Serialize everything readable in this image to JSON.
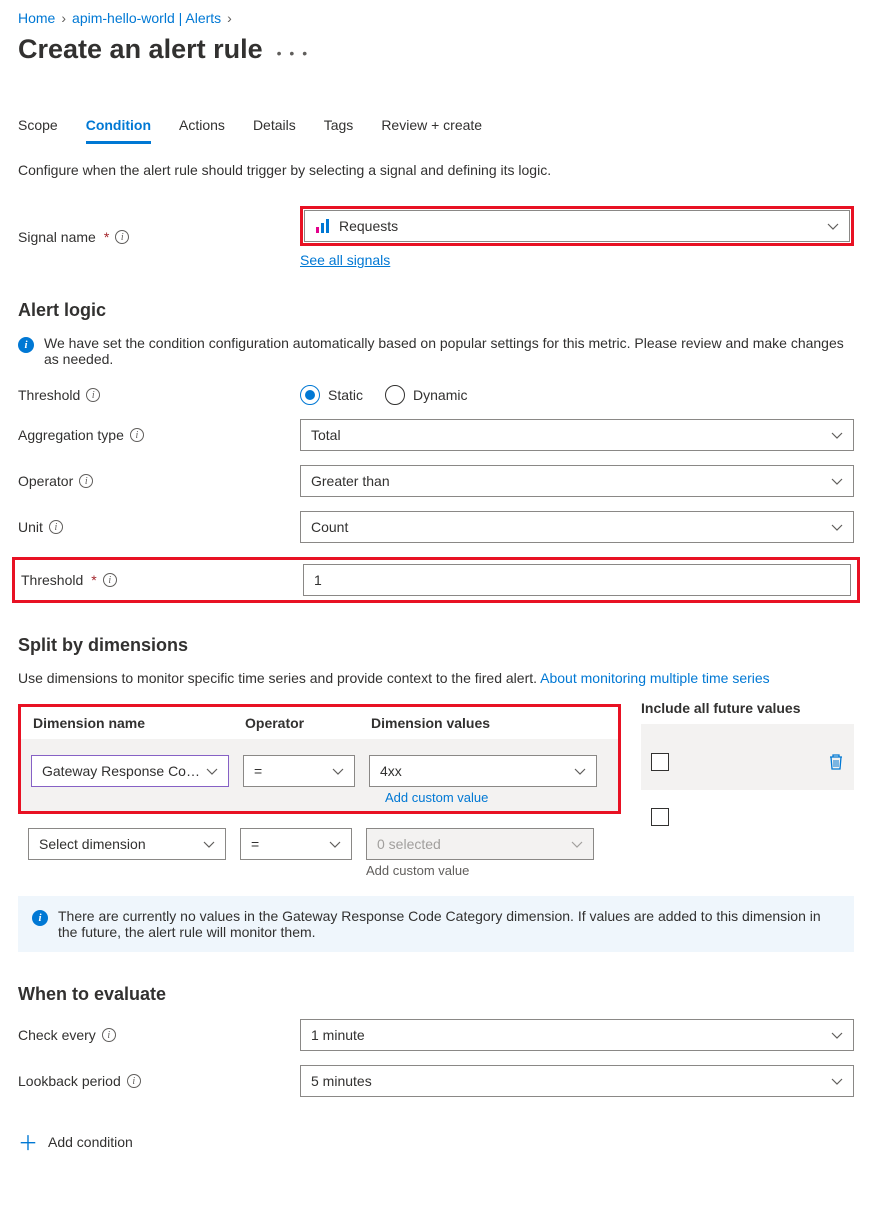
{
  "breadcrumb": {
    "home": "Home",
    "item2": "apim-hello-world | Alerts"
  },
  "page_title": "Create an alert rule",
  "tabs": {
    "scope": "Scope",
    "condition": "Condition",
    "actions": "Actions",
    "details": "Details",
    "tags": "Tags",
    "review": "Review + create"
  },
  "condition_desc": "Configure when the alert rule should trigger by selecting a signal and defining its logic.",
  "signal": {
    "label": "Signal name",
    "value": "Requests",
    "see_all": "See all signals"
  },
  "section_alert_logic": "Alert logic",
  "auto_note": "We have set the condition configuration automatically based on popular settings for this metric. Please review and make changes as needed.",
  "threshold_radio": {
    "label": "Threshold",
    "static": "Static",
    "dynamic": "Dynamic"
  },
  "aggregation": {
    "label": "Aggregation type",
    "value": "Total"
  },
  "operator": {
    "label": "Operator",
    "value": "Greater than"
  },
  "unit": {
    "label": "Unit",
    "value": "Count"
  },
  "threshold_value": {
    "label": "Threshold",
    "value": "1"
  },
  "dimensions": {
    "title": "Split by dimensions",
    "desc_a": "Use dimensions to monitor specific time series and provide context to the fired alert. ",
    "desc_link": "About monitoring multiple time series",
    "col_name": "Dimension name",
    "col_op": "Operator",
    "col_val": "Dimension values",
    "col_future": "Include all future values",
    "row1": {
      "name": "Gateway Response Co…",
      "op": "=",
      "val": "4xx",
      "add": "Add custom value"
    },
    "row2": {
      "name": "Select dimension",
      "op": "=",
      "val": "0 selected",
      "add": "Add custom value"
    },
    "info": "There are currently no values in the Gateway Response Code Category dimension. If values are added to this dimension in the future, the alert rule will monitor them."
  },
  "evaluate": {
    "title": "When to evaluate",
    "check_label": "Check every",
    "check_value": "1 minute",
    "lookback_label": "Lookback period",
    "lookback_value": "5 minutes"
  },
  "add_condition": "Add condition"
}
